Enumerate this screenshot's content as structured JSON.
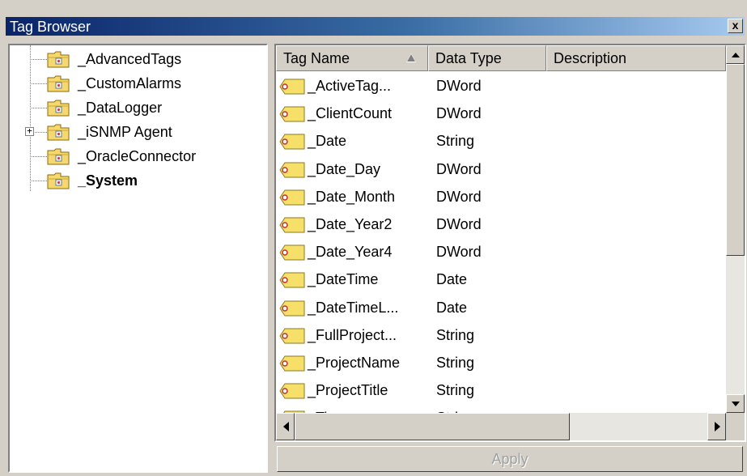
{
  "window": {
    "title": "Tag Browser",
    "close_glyph": "x"
  },
  "tree": {
    "items": [
      {
        "label": "_AdvancedTags",
        "icon": "folder-icon",
        "expandable": false,
        "bold": false
      },
      {
        "label": "_CustomAlarms",
        "icon": "folder-icon",
        "expandable": false,
        "bold": false
      },
      {
        "label": "_DataLogger",
        "icon": "folder-icon",
        "expandable": false,
        "bold": false
      },
      {
        "label": "_iSNMP Agent",
        "icon": "folder-icon",
        "expandable": true,
        "expander_glyph": "+",
        "bold": false
      },
      {
        "label": "_OracleConnector",
        "icon": "folder-icon",
        "expandable": false,
        "bold": false
      },
      {
        "label": "_System",
        "icon": "folder-icon",
        "expandable": false,
        "bold": true
      }
    ]
  },
  "list": {
    "columns": [
      "Tag Name",
      "Data Type",
      "Description"
    ],
    "sorted_column": "Tag Name",
    "rows": [
      {
        "name": "_ActiveTag...",
        "type": "DWord"
      },
      {
        "name": "_ClientCount",
        "type": "DWord"
      },
      {
        "name": "_Date",
        "type": "String"
      },
      {
        "name": "_Date_Day",
        "type": "DWord"
      },
      {
        "name": "_Date_Month",
        "type": "DWord"
      },
      {
        "name": "_Date_Year2",
        "type": "DWord"
      },
      {
        "name": "_Date_Year4",
        "type": "DWord"
      },
      {
        "name": "_DateTime",
        "type": "Date"
      },
      {
        "name": "_DateTimeL...",
        "type": "Date"
      },
      {
        "name": "_FullProject...",
        "type": "String"
      },
      {
        "name": "_ProjectName",
        "type": "String"
      },
      {
        "name": "_ProjectTitle",
        "type": "String"
      },
      {
        "name": "_Time",
        "type": "String"
      }
    ]
  },
  "apply_label": "Apply",
  "colors": {
    "title_start": "#0a246a",
    "title_end": "#a6caf0",
    "face": "#d4d0c8",
    "folder": "#f5d870",
    "tag": "#f7e06a"
  }
}
